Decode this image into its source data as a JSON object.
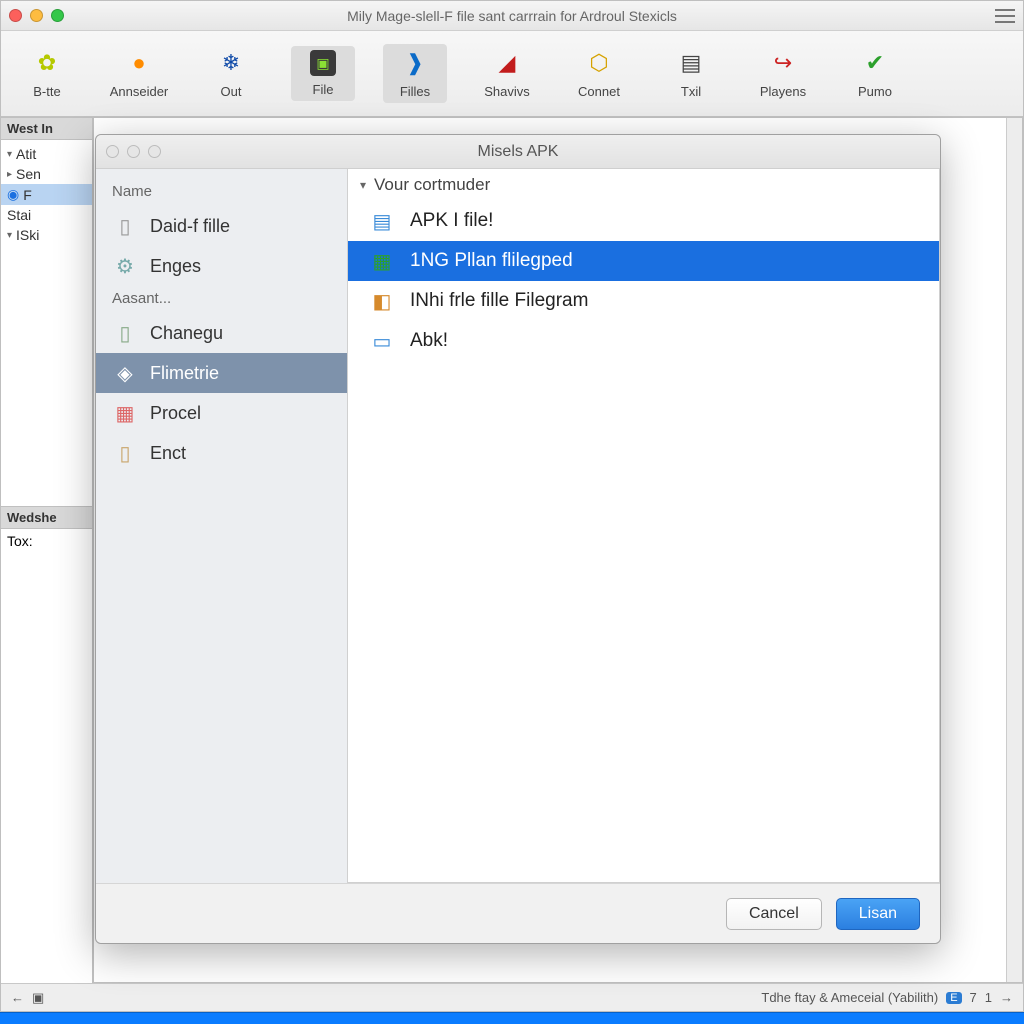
{
  "window": {
    "title": "Mily Mage-slell-F file sant carrrain for Ardroul Stexicls"
  },
  "toolbar": {
    "items": [
      {
        "label": "B-tte"
      },
      {
        "label": "Annseider"
      },
      {
        "label": "Out"
      },
      {
        "label": "File"
      },
      {
        "label": "Filles"
      },
      {
        "label": "Shavivs"
      },
      {
        "label": "Connet"
      },
      {
        "label": "Txil"
      },
      {
        "label": "Playens"
      },
      {
        "label": "Pumo"
      }
    ]
  },
  "left_panel1": {
    "header": "West In",
    "items": [
      "Atit",
      "Sen",
      "F",
      "Stai",
      "ISki"
    ]
  },
  "left_panel2": {
    "header": "Wedshe",
    "line": "Tox:"
  },
  "statusbar": {
    "left_arrow": "←",
    "right_arrow": "→",
    "text": "Tdhe ftay & Ameceial (Yabilith)",
    "badge1": "E",
    "badge2": "1"
  },
  "dialog": {
    "title": "Misels APK",
    "sidebar": {
      "section1_header": "Name",
      "section1_items": [
        "Daid-f fille",
        "Enges"
      ],
      "section2_header": "Aasant...",
      "section2_items": [
        "Chanegu",
        "Flimetrie",
        "Procel",
        "Enct"
      ]
    },
    "pathbar": "Vour cortmuder",
    "files": [
      "APK I file!",
      "1NG Pllan flilegped",
      "INhi frle fille Filegram",
      "Abk!"
    ],
    "selected_file_index": 1,
    "cancel_label": "Cancel",
    "confirm_label": "Lisan"
  }
}
